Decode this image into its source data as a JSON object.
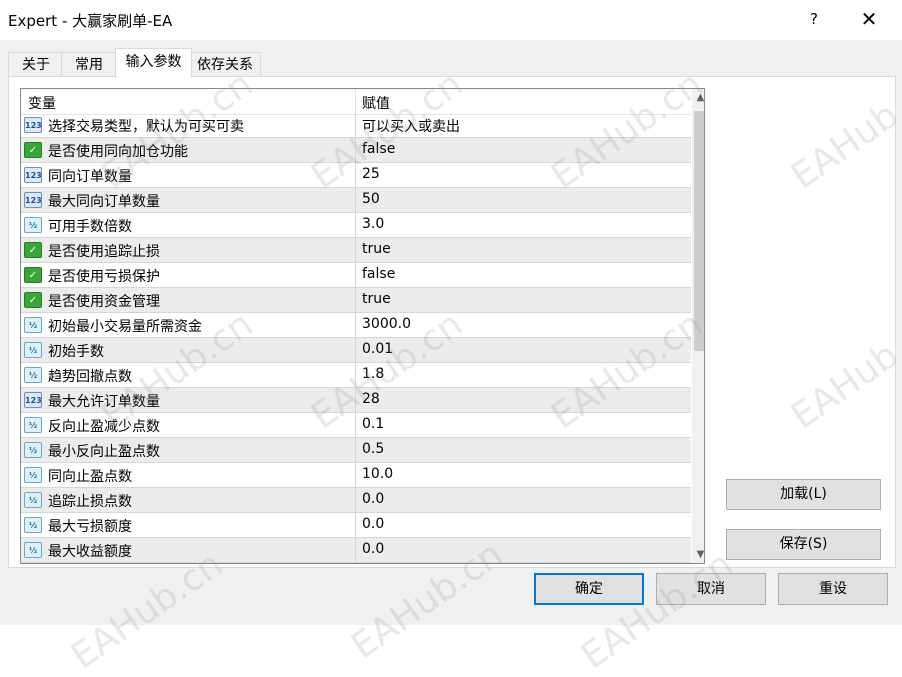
{
  "window": {
    "title": "Expert - 大赢家刷单-EA",
    "help": "?",
    "close": "✕"
  },
  "tabs": [
    {
      "label": "关于"
    },
    {
      "label": "常用"
    },
    {
      "label": "输入参数"
    },
    {
      "label": "依存关系"
    }
  ],
  "grid": {
    "header": {
      "variable": "变量",
      "value": "赋值"
    },
    "rows": [
      {
        "icon": "int-icon",
        "name": "选择交易类型，默认为可买可卖",
        "value": "可以买入或卖出"
      },
      {
        "icon": "bool-icon",
        "name": "是否使用同向加仓功能",
        "value": "false"
      },
      {
        "icon": "int-icon",
        "name": "同向订单数量",
        "value": "25"
      },
      {
        "icon": "int-icon",
        "name": "最大同向订单数量",
        "value": "50"
      },
      {
        "icon": "double-icon",
        "name": "可用手数倍数",
        "value": "3.0"
      },
      {
        "icon": "bool-icon",
        "name": "是否使用追踪止损",
        "value": "true"
      },
      {
        "icon": "bool-icon",
        "name": "是否使用亏损保护",
        "value": "false"
      },
      {
        "icon": "bool-icon",
        "name": "是否使用资金管理",
        "value": "true"
      },
      {
        "icon": "double-icon",
        "name": "初始最小交易量所需资金",
        "value": "3000.0"
      },
      {
        "icon": "double-icon",
        "name": "初始手数",
        "value": "0.01"
      },
      {
        "icon": "double-icon",
        "name": "趋势回撤点数",
        "value": "1.8"
      },
      {
        "icon": "int-icon",
        "name": "最大允许订单数量",
        "value": "28"
      },
      {
        "icon": "double-icon",
        "name": "反向止盈减少点数",
        "value": "0.1"
      },
      {
        "icon": "double-icon",
        "name": "最小反向止盈点数",
        "value": "0.5"
      },
      {
        "icon": "double-icon",
        "name": "同向止盈点数",
        "value": "10.0"
      },
      {
        "icon": "double-icon",
        "name": "追踪止损点数",
        "value": "0.0"
      },
      {
        "icon": "double-icon",
        "name": "最大亏损额度",
        "value": "0.0"
      },
      {
        "icon": "double-icon",
        "name": "最大收益额度",
        "value": "0.0"
      }
    ]
  },
  "icon_glyphs": {
    "int": "123",
    "bool": "✓",
    "double": "½"
  },
  "buttons": {
    "load": "加载(L)",
    "save": "保存(S)",
    "ok": "确定",
    "cancel": "取消",
    "reset": "重设"
  },
  "watermark": "EAHub.cn",
  "colors": {
    "accent": "#0078d7",
    "row_alt": "#ececec",
    "bool_icon": "#3aa63a"
  }
}
